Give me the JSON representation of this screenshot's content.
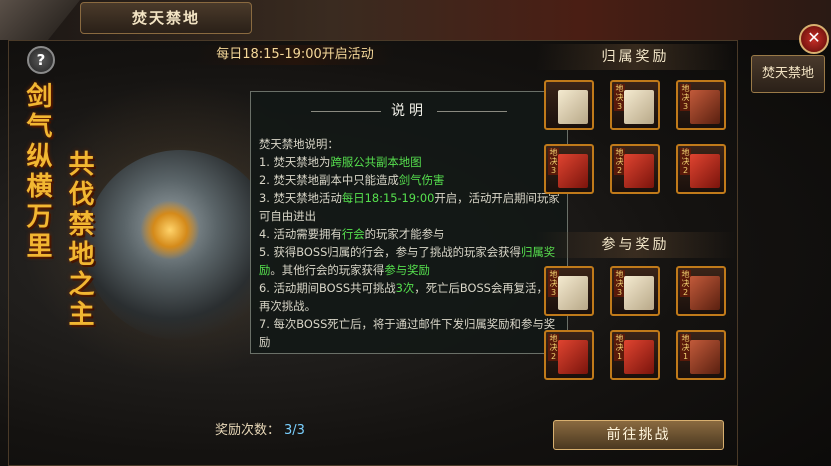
{
  "window": {
    "title": "焚天禁地"
  },
  "event_time": "每日18:15-19:00开启活动",
  "help_label": "?",
  "slogans": {
    "left": "剑气纵横万里",
    "right": "共伐禁地之主"
  },
  "reward_count": {
    "label": "奖励次数：",
    "value": "3/3"
  },
  "dialog": {
    "title": "说明",
    "heading": "焚天禁地说明：",
    "lines": [
      {
        "pre": "1. 焚天禁地为",
        "hl": "跨服公共副本地图",
        "post": ""
      },
      {
        "pre": "2. 焚天禁地副本中只能造成",
        "hl": "剑气伤害",
        "post": ""
      },
      {
        "pre": "3. 焚天禁地活动",
        "hl": "每日18:15-19:00",
        "post": "开启，活动开启期间玩家可自由进出"
      },
      {
        "pre": "4. 活动需要拥有",
        "hl": "行会",
        "post": "的玩家才能参与"
      },
      {
        "pre": "5. 获得BOSS归属的行会，参与了挑战的玩家会获得",
        "hl": "归属奖励",
        "post": "。其他行会的玩家获得",
        "hl2": "参与奖励"
      },
      {
        "pre": "6. 活动期间BOSS共可挑战",
        "hl": "3次",
        "post": "，死亡后BOSS会再复活，可再次挑战。"
      },
      {
        "pre": "7. 每次BOSS死亡后，将于通过邮件下发归属奖励和参与奖励",
        "hl": "",
        "post": ""
      }
    ]
  },
  "side_tab": "焚天禁地",
  "close_label": "✕",
  "rewards": {
    "ownership": {
      "title": "归属奖励",
      "items": [
        {
          "tag": "",
          "kind": "paper"
        },
        {
          "tag": "地决3",
          "kind": "paper"
        },
        {
          "tag": "地决3",
          "kind": "tome"
        },
        {
          "tag": "地决3",
          "kind": "red"
        },
        {
          "tag": "地决2",
          "kind": "red"
        },
        {
          "tag": "地决2",
          "kind": "red"
        }
      ]
    },
    "participation": {
      "title": "参与奖励",
      "items": [
        {
          "tag": "地决3",
          "kind": "paper"
        },
        {
          "tag": "地决3",
          "kind": "paper"
        },
        {
          "tag": "地决2",
          "kind": "tome"
        },
        {
          "tag": "地决2",
          "kind": "red"
        },
        {
          "tag": "地决1",
          "kind": "red"
        },
        {
          "tag": "地决1",
          "kind": "tome"
        }
      ]
    }
  },
  "challenge_button": "前往挑战"
}
